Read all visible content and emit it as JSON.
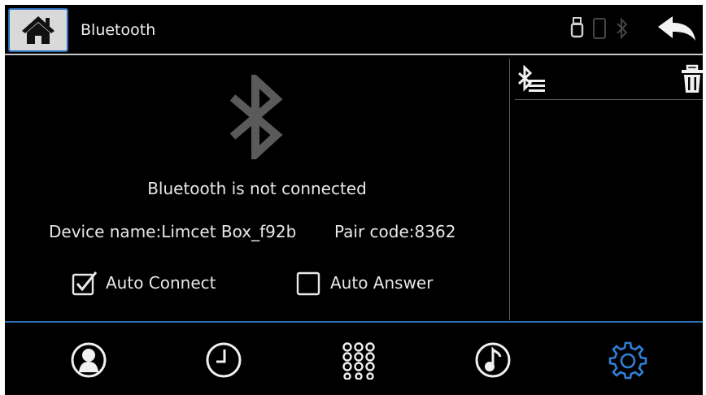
{
  "header": {
    "title": "Bluetooth",
    "icons": [
      "home-icon",
      "usb-icon",
      "phone-icon",
      "bluetooth-status-icon",
      "back-arrow-icon"
    ]
  },
  "main": {
    "status_text": "Bluetooth is not connected",
    "device_name": "Device name:Limcet Box_f92b",
    "pair_code": "Pair code:8362",
    "auto_connect": {
      "label": "Auto Connect",
      "checked": true
    },
    "auto_answer": {
      "label": "Auto Answer",
      "checked": false
    }
  },
  "right_panel": {
    "icons": [
      "bluetooth-device-list-icon",
      "trash-icon"
    ]
  },
  "nav": {
    "items": [
      "contacts-icon",
      "call-history-icon",
      "dialpad-icon",
      "music-icon",
      "settings-icon"
    ],
    "active": "settings-icon"
  },
  "colors": {
    "background": "#000000",
    "accent": "#2c6db3",
    "text": "#e8e8e8",
    "icon_dim": "#555555"
  }
}
